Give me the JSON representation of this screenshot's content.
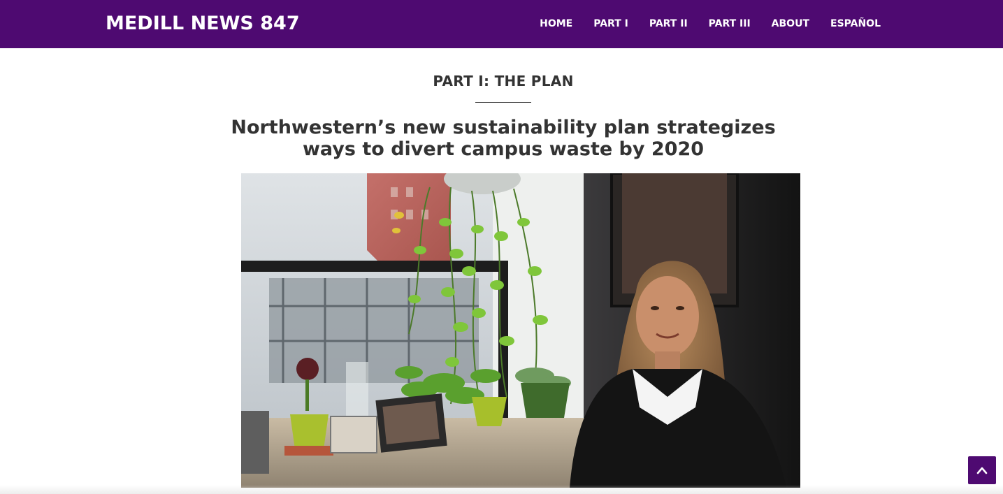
{
  "site": {
    "title": "MEDILL NEWS 847",
    "brand_color": "#4e0a71"
  },
  "nav": {
    "items": [
      {
        "label": "HOME"
      },
      {
        "label": "PART I"
      },
      {
        "label": "PART II"
      },
      {
        "label": "PART III"
      },
      {
        "label": "ABOUT"
      },
      {
        "label": "ESPAÑOL"
      }
    ]
  },
  "article": {
    "kicker": "PART I: THE PLAN",
    "headline": "Northwestern’s new sustainability plan strategizes ways to divert campus waste by 2020",
    "image": {
      "alt": "Woman seated beside a window filled with hanging and potted plants"
    }
  },
  "back_to_top": {
    "icon": "chevron-up-icon"
  }
}
